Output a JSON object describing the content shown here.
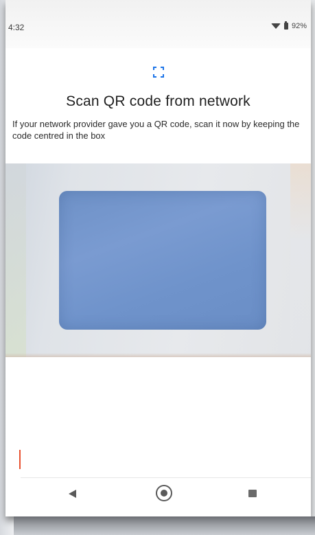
{
  "status_bar": {
    "time": "4:32",
    "battery": "92%",
    "wifi_icon": "wifi-icon",
    "battery_icon": "battery-icon"
  },
  "scan": {
    "icon": "qr-scan-icon",
    "accent": "#1a73e8",
    "title": "Scan QR code from network",
    "description": "If your network provider gave you a QR code, scan it now by keeping the code centred in the box"
  },
  "camera": {
    "viewfinder_color": "#7499cf"
  },
  "nav": {
    "back_icon": "back-triangle-icon",
    "home_icon": "home-circle-icon",
    "recents_icon": "recents-square-icon"
  }
}
